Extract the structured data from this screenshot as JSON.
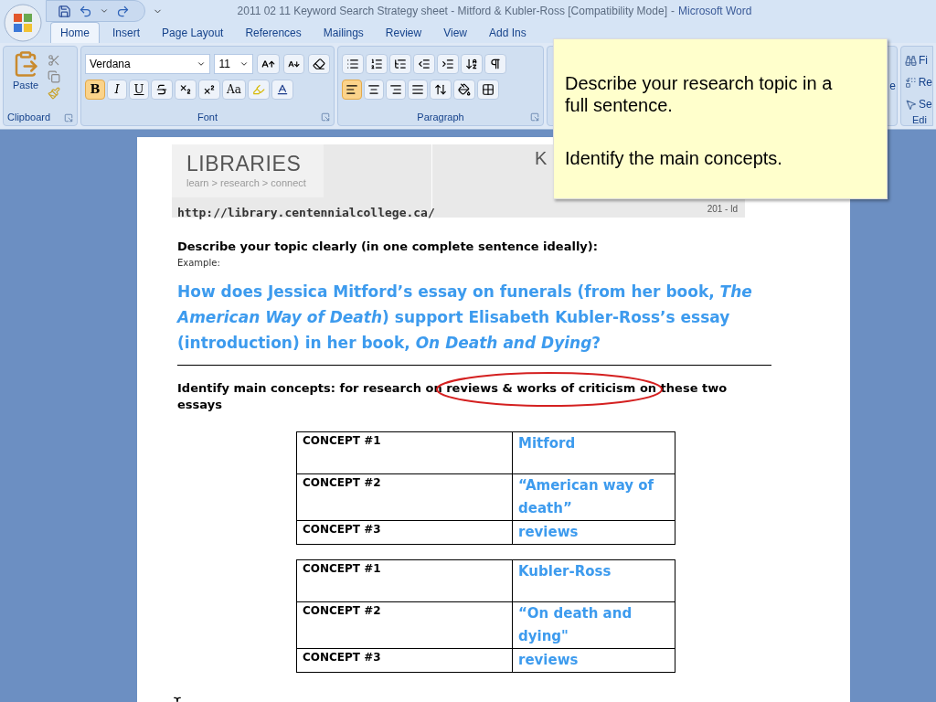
{
  "title_bar": {
    "title": "2011 02 11 Keyword Search Strategy sheet - Mitford & Kubler-Ross [Compatibility Mode]",
    "separator": "-",
    "app": "Microsoft Word"
  },
  "tabs": [
    {
      "label": "Home",
      "selected": true
    },
    {
      "label": "Insert",
      "selected": false
    },
    {
      "label": "Page Layout",
      "selected": false
    },
    {
      "label": "References",
      "selected": false
    },
    {
      "label": "Mailings",
      "selected": false
    },
    {
      "label": "Review",
      "selected": false
    },
    {
      "label": "View",
      "selected": false
    },
    {
      "label": "Add Ins",
      "selected": false
    }
  ],
  "ribbon": {
    "paste_label": "Paste",
    "font_name": "Verdana",
    "font_size": "11",
    "format_buttons": [
      {
        "kind": "bold",
        "label": "B",
        "selected": true
      },
      {
        "kind": "italic",
        "label": "I",
        "selected": false
      },
      {
        "kind": "underline",
        "label": "U",
        "selected": false
      }
    ],
    "change_case": "Aa",
    "alignment": [
      {
        "kind": "left",
        "selected": true
      },
      {
        "kind": "center",
        "selected": false
      },
      {
        "kind": "right",
        "selected": false
      },
      {
        "kind": "justify",
        "selected": false
      }
    ],
    "groups": [
      "Clipboard",
      "Font",
      "Paragraph"
    ],
    "styles_fragment": "e",
    "editing": [
      "Fi",
      "Re",
      "Se"
    ],
    "editing_group": "Edi"
  },
  "sticky_note": [
    "Describe your research topic in a full sentence.",
    "Identify the main concepts."
  ],
  "document": {
    "banner": {
      "title": "LIBRARIES",
      "tagline": "learn > research > connect",
      "url": "http://library.centennialcollege.ca/",
      "heading_fragment": "K",
      "code": "201 - ld"
    },
    "prompt": "Describe your topic clearly (in one complete sentence ideally):",
    "example_label": "Example:",
    "question": "How does Jessica Mitford’s essay on funerals (from her book, *The American Way of Death*) support Elisabeth Kubler-Ross’s essay (introduction) in her book, *On Death and Dying*?",
    "concepts_prompt": {
      "before": "Identify main concepts: for research on",
      "circled": "reviews & works of criticism",
      "after": "on these two",
      "continuation": "essays"
    },
    "tables": [
      [
        {
          "label": "CONCEPT #1",
          "value": "Mitford"
        },
        {
          "label": "CONCEPT #2",
          "value": "“American way of death”"
        },
        {
          "label": "CONCEPT #3",
          "value": "reviews"
        }
      ],
      [
        {
          "label": "CONCEPT #1",
          "value": "Kubler-Ross"
        },
        {
          "label": "CONCEPT #2",
          "value": "“On death and dying\""
        },
        {
          "label": "CONCEPT #3",
          "value": "reviews"
        }
      ]
    ]
  }
}
